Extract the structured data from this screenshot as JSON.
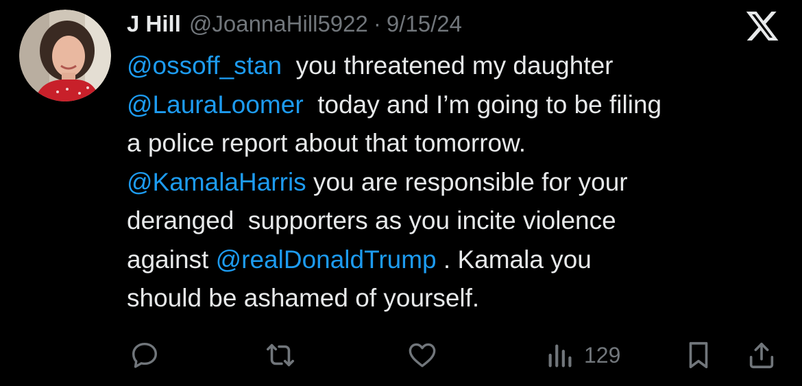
{
  "author": {
    "display_name": "J Hill",
    "handle": "@JoannaHill5922",
    "separator": "·",
    "date": "9/15/24"
  },
  "tweet": {
    "lines": [
      [
        {
          "text": "@ossoff_stan",
          "mention": true
        },
        {
          "text": "  you threatened my daughter",
          "mention": false
        }
      ],
      [
        {
          "text": "@LauraLoomer",
          "mention": true
        },
        {
          "text": "  today and I’m going to be filing",
          "mention": false
        }
      ],
      [
        {
          "text": "a police report about that tomorrow.",
          "mention": false
        }
      ],
      [
        {
          "text": "@KamalaHarris",
          "mention": true
        },
        {
          "text": " you are responsible for your",
          "mention": false
        }
      ],
      [
        {
          "text": "deranged  supporters as you incite violence",
          "mention": false
        }
      ],
      [
        {
          "text": "against ",
          "mention": false
        },
        {
          "text": "@realDonaldTrump",
          "mention": true
        },
        {
          "text": " . Kamala you",
          "mention": false
        }
      ],
      [
        {
          "text": "should be ashamed of yourself.",
          "mention": false
        }
      ]
    ]
  },
  "actions": {
    "reply_icon": "speech-bubble-icon",
    "repost_icon": "repost-arrows-icon",
    "like_icon": "heart-icon",
    "views_icon": "bar-chart-icon",
    "views_count": "129",
    "bookmark_icon": "bookmark-icon",
    "share_icon": "share-upload-icon"
  },
  "brand": {
    "logo_icon": "x-logo-icon"
  },
  "colors": {
    "background": "#000000",
    "text": "#e7e9ea",
    "secondary": "#71767b",
    "mention": "#1d9bf0"
  }
}
